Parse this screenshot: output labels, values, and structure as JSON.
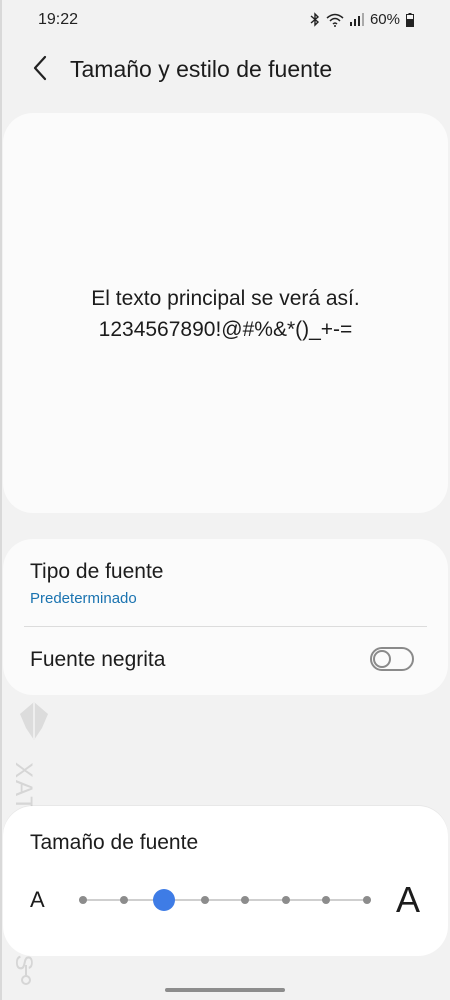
{
  "status_bar": {
    "time": "19:22",
    "battery": "60%",
    "icons": [
      "bluetooth-icon",
      "wifi-icon",
      "signal-icon",
      "battery-icon"
    ]
  },
  "header": {
    "back_icon": "chevron-left-icon",
    "title": "Tamaño y estilo de fuente"
  },
  "preview": {
    "line1": "El texto principal se verá así.",
    "line2": "1234567890!@#%&*()_+-="
  },
  "options": {
    "font_type": {
      "label": "Tipo de fuente",
      "value": "Predeterminado"
    },
    "bold_font": {
      "label": "Fuente negrita",
      "enabled": false
    }
  },
  "font_size": {
    "title": "Tamaño de fuente",
    "small_label": "A",
    "large_label": "A",
    "steps": 8,
    "selected_step": 3
  },
  "watermark": {
    "text": "XATAKA BASICS"
  },
  "colors": {
    "accent": "#3e7ce6",
    "link": "#1a73b0",
    "background": "#f2f2f2",
    "card": "#fbfbfb"
  }
}
